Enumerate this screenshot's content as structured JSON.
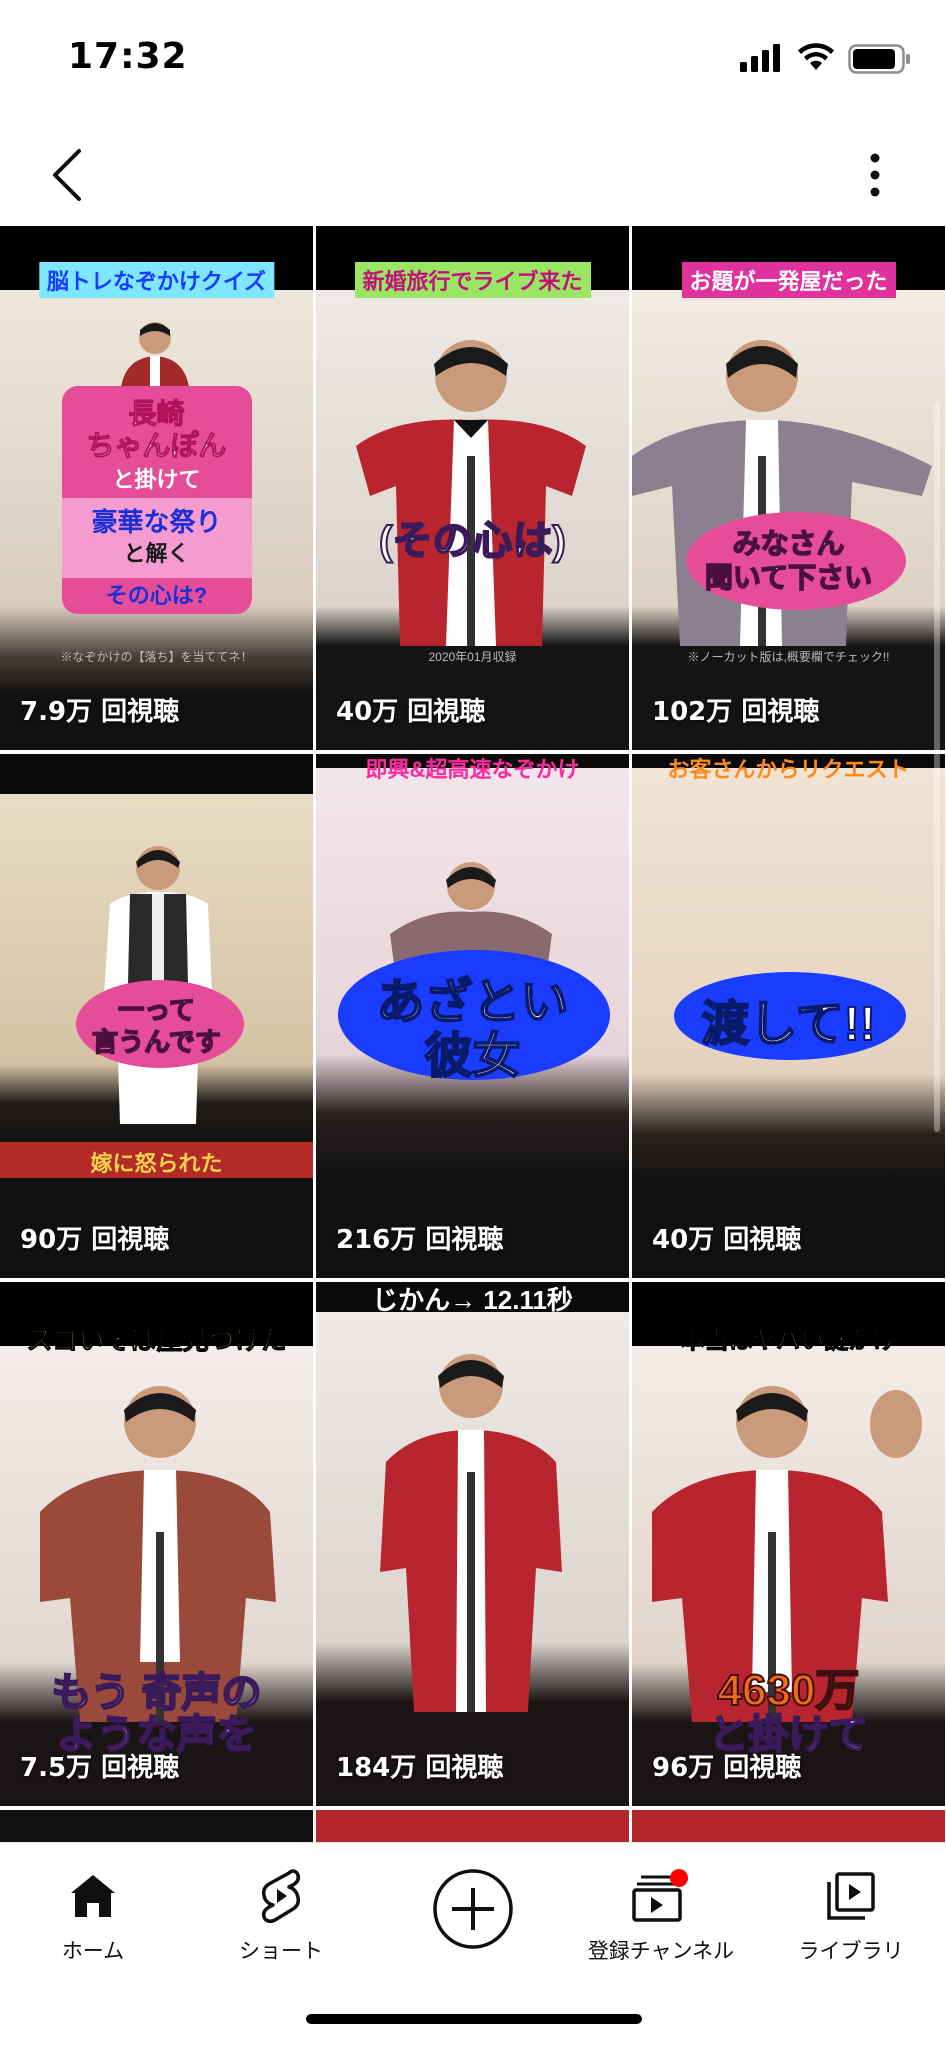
{
  "status": {
    "time": "17:32"
  },
  "colors": {
    "accent": "#ff0000",
    "text": "#0f0f0f"
  },
  "tiles": [
    {
      "headline": "脳トレなぞかけクイズ",
      "captions": [
        "長崎",
        "ちゃんぽん",
        "と掛けて",
        "豪華な祭り",
        "と解く",
        "その心は?"
      ],
      "note": "※なぞかけの【落ち】を当ててネ！",
      "views": "7.9万 回視聴"
    },
    {
      "headline": "新婚旅行でライブ来た",
      "captions": [
        "(その心は)"
      ],
      "note": "2020年01月収録",
      "views": "40万 回視聴"
    },
    {
      "headline": "お題が一発屋だった",
      "captions": [
        "みなさん",
        "聞いて下さい"
      ],
      "note": "※ノーカット版は,概要欄でチェック!!",
      "views": "102万 回視聴"
    },
    {
      "headline": "",
      "captions": [
        "一って",
        "言うんです",
        "嫁に怒られた"
      ],
      "note": "",
      "views": "90万 回視聴"
    },
    {
      "headline": "即興&超高速なぞかけ",
      "captions": [
        "あざとい",
        "彼女"
      ],
      "note": "",
      "views": "216万 回視聴"
    },
    {
      "headline": "お客さんからリクエスト",
      "captions": [
        "渡して!!"
      ],
      "note": "",
      "views": "40万 回視聴"
    },
    {
      "headline": "スゴいそば屋見つけた",
      "captions": [
        "もう 奇声の",
        "ような声を"
      ],
      "note": "",
      "views": "7.5万 回視聴"
    },
    {
      "headline": "じかん→ 12.11秒",
      "captions": [],
      "note": "",
      "views": "184万 回視聴"
    },
    {
      "headline": "本当はヤバい謎かけ",
      "captions": [
        "4630万",
        "と掛けて"
      ],
      "note": "",
      "views": "96万 回視聴"
    }
  ],
  "nav": {
    "home": "ホーム",
    "shorts": "ショート",
    "subscriptions": "登録チャンネル",
    "library": "ライブラリ"
  }
}
